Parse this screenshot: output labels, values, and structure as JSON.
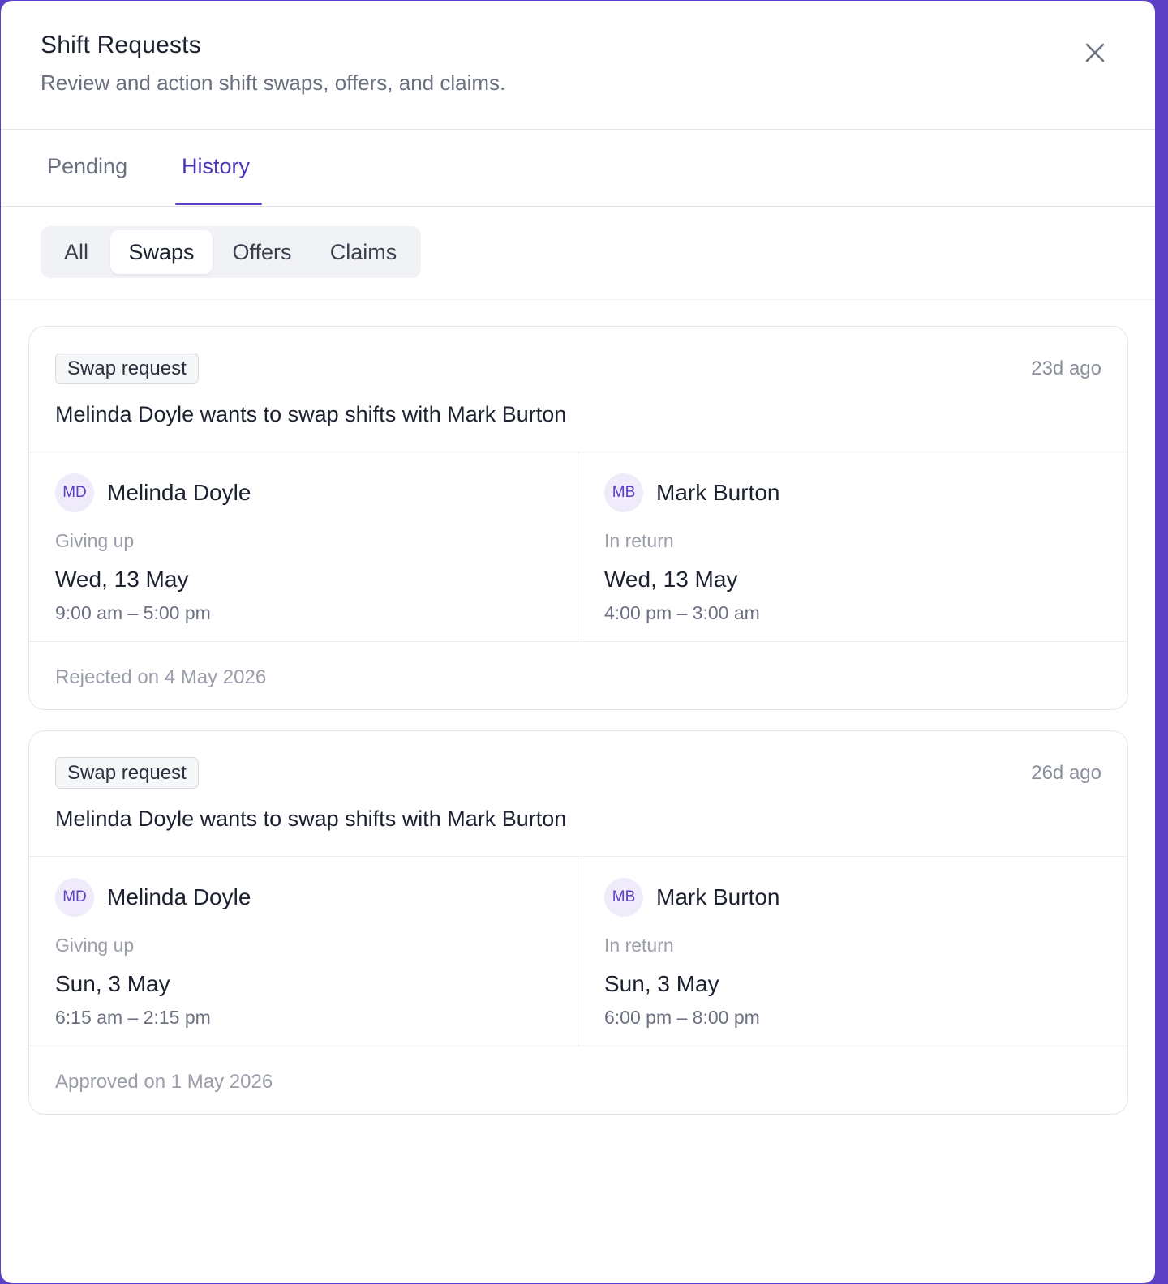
{
  "header": {
    "title": "Shift Requests",
    "subtitle": "Review and action shift swaps, offers, and claims."
  },
  "tabs": [
    {
      "label": "Pending",
      "active": false
    },
    {
      "label": "History",
      "active": true
    }
  ],
  "filters": {
    "options": [
      "All",
      "Swaps",
      "Offers",
      "Claims"
    ],
    "selected": "Swaps"
  },
  "colors": {
    "accent": "#5b3fc4"
  },
  "requests": [
    {
      "type": "Swap request",
      "ago": "23d ago",
      "title": "Melinda Doyle wants to swap shifts with Mark Burton",
      "from": {
        "initials": "MD",
        "name": "Melinda Doyle",
        "role": "Giving up",
        "date": "Wed, 13 May",
        "time": "9:00 am – 5:00 pm"
      },
      "to": {
        "initials": "MB",
        "name": "Mark Burton",
        "role": "In return",
        "date": "Wed, 13 May",
        "time": "4:00 pm – 3:00 am"
      },
      "status": "Rejected on 4 May 2026"
    },
    {
      "type": "Swap request",
      "ago": "26d ago",
      "title": "Melinda Doyle wants to swap shifts with Mark Burton",
      "from": {
        "initials": "MD",
        "name": "Melinda Doyle",
        "role": "Giving up",
        "date": "Sun, 3 May",
        "time": "6:15 am – 2:15 pm"
      },
      "to": {
        "initials": "MB",
        "name": "Mark Burton",
        "role": "In return",
        "date": "Sun, 3 May",
        "time": "6:00 pm – 8:00 pm"
      },
      "status": "Approved on 1 May 2026"
    }
  ]
}
